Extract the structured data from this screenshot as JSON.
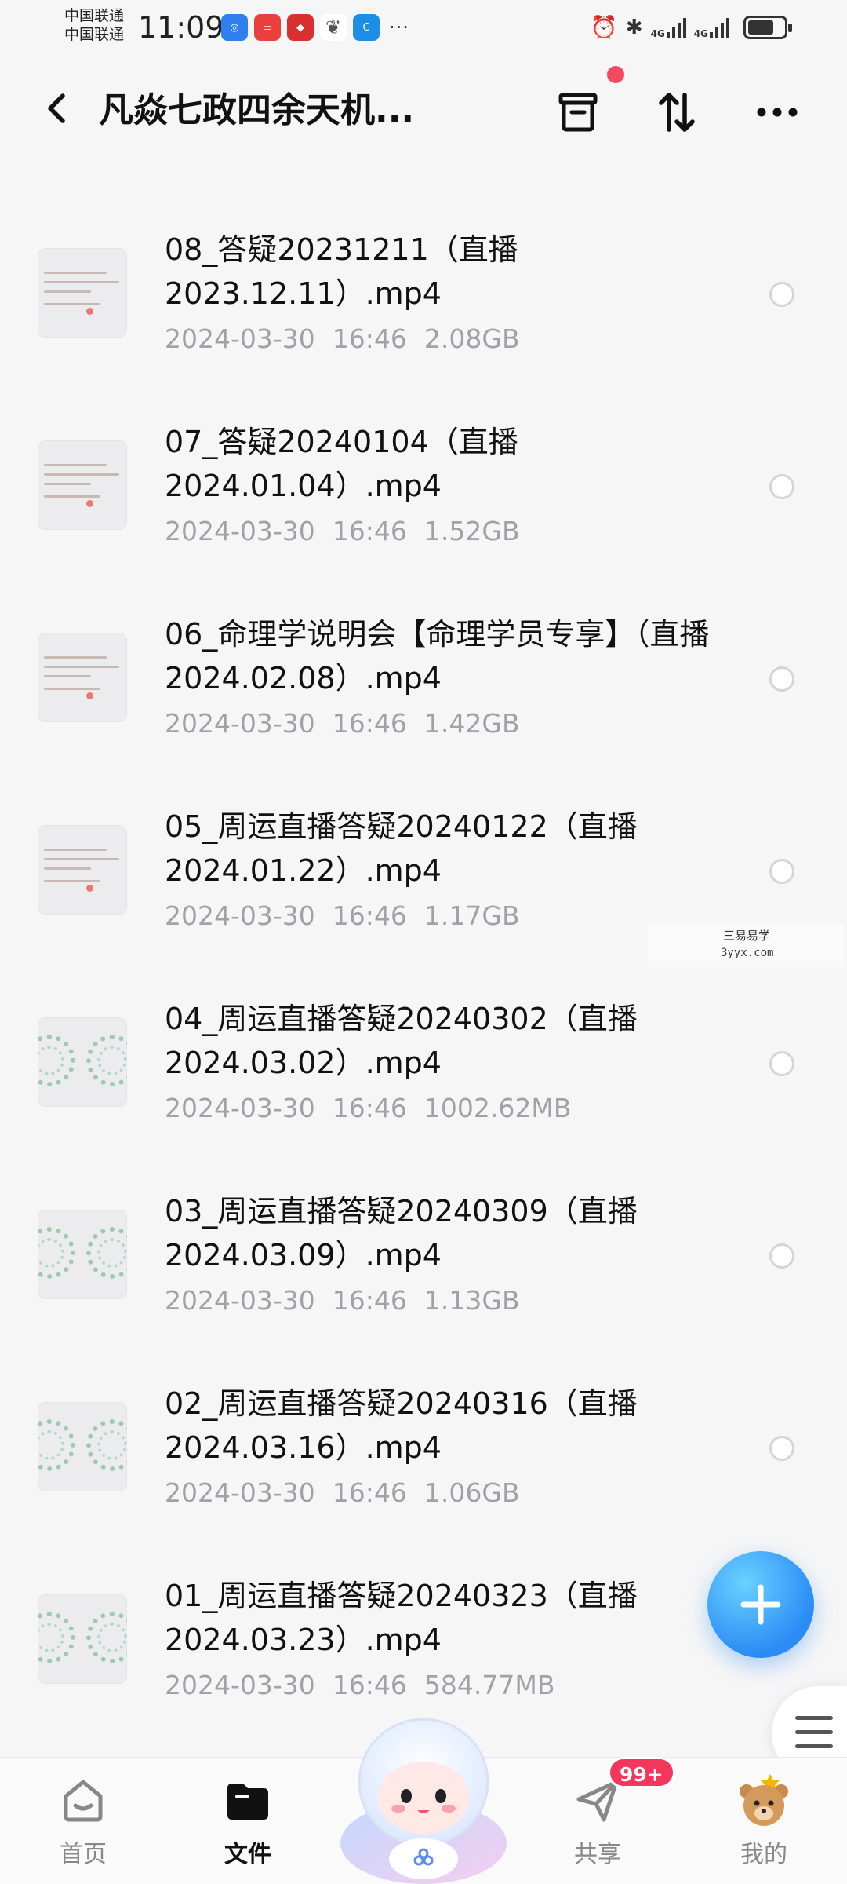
{
  "status_bar": {
    "carrier_1": "中国联通",
    "carrier_2": "中国联通",
    "time": "11:09",
    "network_1": "4G",
    "network_2": "4G"
  },
  "header": {
    "title": "凡焱七政四余天机..."
  },
  "files": [
    {
      "name": "08_答疑20231211（直播2023.12.11）.mp4",
      "date": "2024-03-30",
      "time": "16:46",
      "size": "2.08GB",
      "thumb": "doc"
    },
    {
      "name": "07_答疑20240104（直播2024.01.04）.mp4",
      "date": "2024-03-30",
      "time": "16:46",
      "size": "1.52GB",
      "thumb": "doc"
    },
    {
      "name": "06_命理学说明会【命理学员专享】（直播2024.02.08）.mp4",
      "date": "2024-03-30",
      "time": "16:46",
      "size": "1.42GB",
      "thumb": "doc"
    },
    {
      "name": "05_周运直播答疑20240122（直播2024.01.22）.mp4",
      "date": "2024-03-30",
      "time": "16:46",
      "size": "1.17GB",
      "thumb": "doc"
    },
    {
      "name": "04_周运直播答疑20240302（直播2024.03.02）.mp4",
      "date": "2024-03-30",
      "time": "16:46",
      "size": "1002.62MB",
      "thumb": "wheel"
    },
    {
      "name": "03_周运直播答疑20240309（直播2024.03.09）.mp4",
      "date": "2024-03-30",
      "time": "16:46",
      "size": "1.13GB",
      "thumb": "wheel"
    },
    {
      "name": "02_周运直播答疑20240316（直播2024.03.16）.mp4",
      "date": "2024-03-30",
      "time": "16:46",
      "size": "1.06GB",
      "thumb": "wheel"
    },
    {
      "name": "01_周运直播答疑20240323（直播2024.03.23）.mp4",
      "date": "2024-03-30",
      "time": "16:46",
      "size": "584.77MB",
      "thumb": "wheel"
    }
  ],
  "watermark": {
    "line1": "三易易学",
    "line2": "3yyx.com"
  },
  "bottom_nav": {
    "items": [
      {
        "label": "首页",
        "active": false
      },
      {
        "label": "文件",
        "active": true
      },
      {
        "label": "共享",
        "active": false
      },
      {
        "label": "我的",
        "active": false
      }
    ],
    "share_badge": "99+"
  },
  "colors": {
    "accent": "#2b8cf5",
    "badge": "#f5365c",
    "meta_text": "#a2a2a6"
  }
}
